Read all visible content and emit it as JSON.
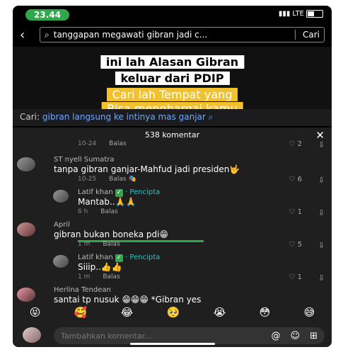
{
  "status": {
    "time": "23.44",
    "network": "LTE"
  },
  "search": {
    "query": "tanggapan megawati gibran jadi c...",
    "button": "Cari"
  },
  "video": {
    "captions": [
      "ini lah Alasan Gibran",
      "keluar dari PDIP",
      "Cari lah Tempat yang",
      "Bisa menghargai kamu"
    ]
  },
  "hint": {
    "label": "Cari:",
    "query": "gibran langsung ke intinya mas ganjar"
  },
  "comments_panel": {
    "count_label": "538 komentar",
    "close": "✕",
    "top_partial": {
      "time": "10-24",
      "reply": "Balas",
      "likes": "2"
    },
    "comments": [
      {
        "user": "ST nyell Sumatra",
        "text": "tanpa gibran ganjar-Mahfud jadi presiden🤟",
        "time": "10-25",
        "reply": "Balas",
        "likes": "6"
      },
      {
        "user": "Latif khan",
        "creator": "· Pencipta",
        "text": "Mantab..🙏🙏",
        "time": "6 h",
        "reply": "Balas",
        "likes": "1"
      },
      {
        "user": "April",
        "text": "gibran bukan boneka pdi😁",
        "time": "1 m",
        "reply": "Balas",
        "likes": "5"
      },
      {
        "user": "Latif khan",
        "creator": "· Pencipta",
        "text": "Siiip..👍👍",
        "time": "1 m",
        "reply": "Balas",
        "likes": "1"
      },
      {
        "user": "Herlina Tendean",
        "text": "santai tp nusuk 😁😁😁 *Gibran yes"
      }
    ],
    "emojis": [
      "😝",
      "🥰",
      "😂",
      "🥺",
      "😭",
      "😳",
      "😅"
    ],
    "input_placeholder": "Tambahkan komentar..."
  }
}
